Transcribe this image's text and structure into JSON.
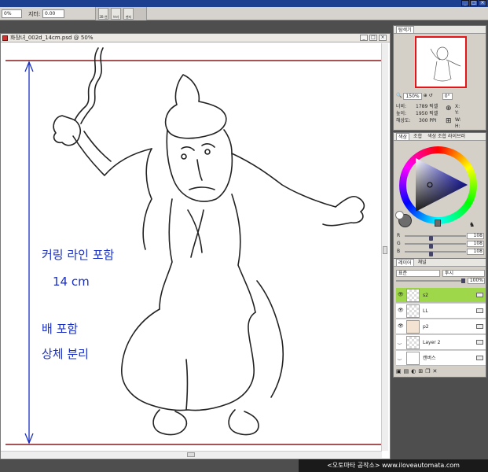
{
  "toolbar": {
    "field1_value": "0%",
    "jitter_label": "지터:",
    "jitter_value": "0.00",
    "toolbox_labels": [
      "2B 연필",
      "브러시",
      "펜지우"
    ]
  },
  "document": {
    "title": "화장녀_002d_14cm.psd @ 50%",
    "annotations": [
      "커링 라인 포함",
      "14 cm",
      "배 포함",
      "상체 분리"
    ]
  },
  "navigator": {
    "tab": "탐색기",
    "zoom": "150%",
    "rotation": "0°",
    "width_label": "너비:",
    "width_value": "1789 픽셀",
    "height_label": "높이:",
    "height_value": "1950 픽셀",
    "res_label": "해상도:",
    "res_value": "300 PPI",
    "coords": [
      "X:",
      "Y:",
      "W:",
      "H:"
    ]
  },
  "color": {
    "tabs": [
      "색상",
      "조합",
      "색상 조합 라이브러"
    ],
    "sliders": [
      {
        "name": "R",
        "value": "108",
        "level": 0.42
      },
      {
        "name": "G",
        "value": "108",
        "level": 0.42
      },
      {
        "name": "B",
        "value": "108",
        "level": 0.42
      }
    ]
  },
  "layers": {
    "tabs": [
      "레이어",
      "채널"
    ],
    "blend_mode": "표준",
    "lock_label": "투시",
    "opacity": "100%",
    "items": [
      {
        "name": "s2",
        "selected": true
      },
      {
        "name": "LL",
        "selected": false
      },
      {
        "name": "p2",
        "selected": false
      },
      {
        "name": "Layer 2",
        "selected": false
      },
      {
        "name": "캔버스",
        "selected": false
      }
    ]
  },
  "watermark": "<오토마타 공작소> www.iloveautomata.com",
  "colors": {
    "accent": "#1c3f8f",
    "selected_layer": "#9ed84a",
    "nav_frame": "#e4141a",
    "guide": "#1a2fbf",
    "crop_line": "#8b1a1a"
  }
}
